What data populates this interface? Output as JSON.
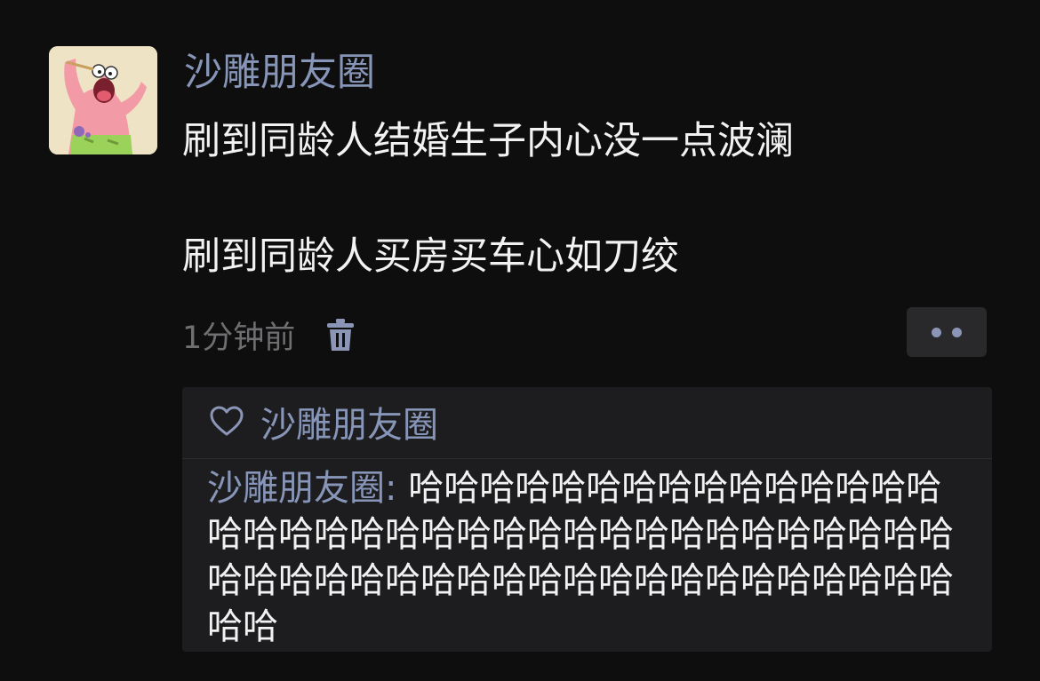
{
  "post": {
    "author": "沙雕朋友圈",
    "avatar_icon": "patrick-star-avatar-icon",
    "lines": [
      "刷到同龄人结婚生子内心没一点波澜",
      "刷到同龄人买房买车心如刀绞"
    ],
    "timestamp": "1分钟前",
    "delete_icon": "trash-icon",
    "more_icon": "more-dots-icon"
  },
  "interactions": {
    "like_icon": "heart-outline-icon",
    "likers": "沙雕朋友圈",
    "comments": [
      {
        "author": "沙雕朋友圈",
        "separator": ": ",
        "text": "哈哈哈哈哈哈哈哈哈哈哈哈哈哈哈哈哈哈哈哈哈哈哈哈哈哈哈哈哈哈哈哈哈哈哈哈哈哈哈哈哈哈哈哈哈哈哈哈哈哈哈哈哈哈哈哈哈哈哈"
      }
    ]
  },
  "colors": {
    "background": "#0e0e0f",
    "name_link": "#8796b8",
    "body_text": "#f2f2f2",
    "timestamp": "#6f6f72",
    "comment_panel": "#1d1d1f"
  }
}
